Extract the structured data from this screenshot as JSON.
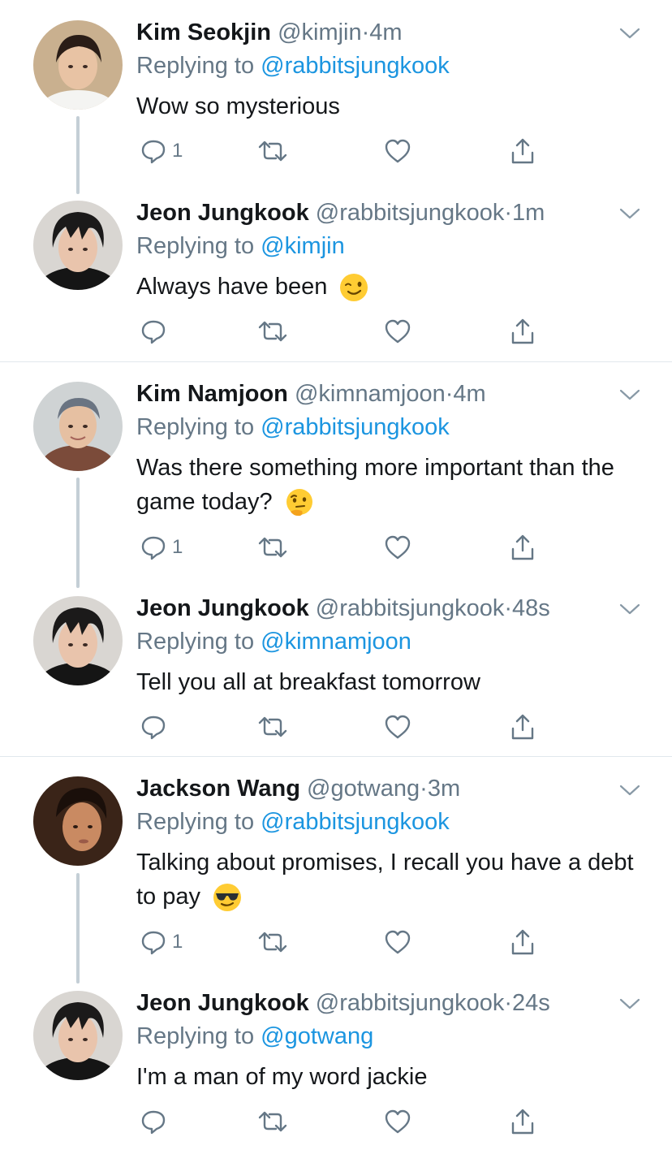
{
  "threads": [
    {
      "tweets": [
        {
          "name": "Kim Seokjin",
          "handle": "@kimjin",
          "dot": "·",
          "time": "4m",
          "reply_prefix": "Replying to",
          "reply_to": "@rabbitsjungkook",
          "text": "Wow so mysterious",
          "emoji": "",
          "reply_count": "1"
        },
        {
          "name": "Jeon Jungkook",
          "handle": "@rabbitsjungkook",
          "dot": "·",
          "time": "1m",
          "reply_prefix": "Replying to",
          "reply_to": "@kimjin",
          "text": "Always have been",
          "emoji": "winking-face",
          "reply_count": ""
        }
      ]
    },
    {
      "tweets": [
        {
          "name": "Kim Namjoon",
          "handle": "@kimnamjoon",
          "dot": "·",
          "time": "4m",
          "reply_prefix": "Replying to",
          "reply_to": "@rabbitsjungkook",
          "text": "Was there something more important than the game today?",
          "emoji": "thinking-face",
          "reply_count": "1"
        },
        {
          "name": "Jeon Jungkook",
          "handle": "@rabbitsjungkook",
          "dot": "·",
          "time": "48s",
          "reply_prefix": "Replying to",
          "reply_to": "@kimnamjoon",
          "text": "Tell you all at breakfast tomorrow",
          "emoji": "",
          "reply_count": ""
        }
      ]
    },
    {
      "tweets": [
        {
          "name": "Jackson Wang",
          "handle": "@gotwang",
          "dot": "·",
          "time": "3m",
          "reply_prefix": "Replying to",
          "reply_to": "@rabbitsjungkook",
          "text": "Talking about promises, I recall you have a debt to pay",
          "emoji": "sunglasses-face",
          "reply_count": "1"
        },
        {
          "name": "Jeon Jungkook",
          "handle": "@rabbitsjungkook",
          "dot": "·",
          "time": "24s",
          "reply_prefix": "Replying to",
          "reply_to": "@gotwang",
          "text": "I'm a man of my word jackie",
          "emoji": "",
          "reply_count": ""
        }
      ]
    }
  ],
  "colors": {
    "link": "#1b95e0",
    "secondary": "#657786",
    "text": "#14171a",
    "connector": "#c4cfd6"
  },
  "icons": {
    "reply": "reply-icon",
    "retweet": "retweet-icon",
    "like": "heart-icon",
    "share": "share-icon",
    "menu": "chevron-down-icon"
  }
}
